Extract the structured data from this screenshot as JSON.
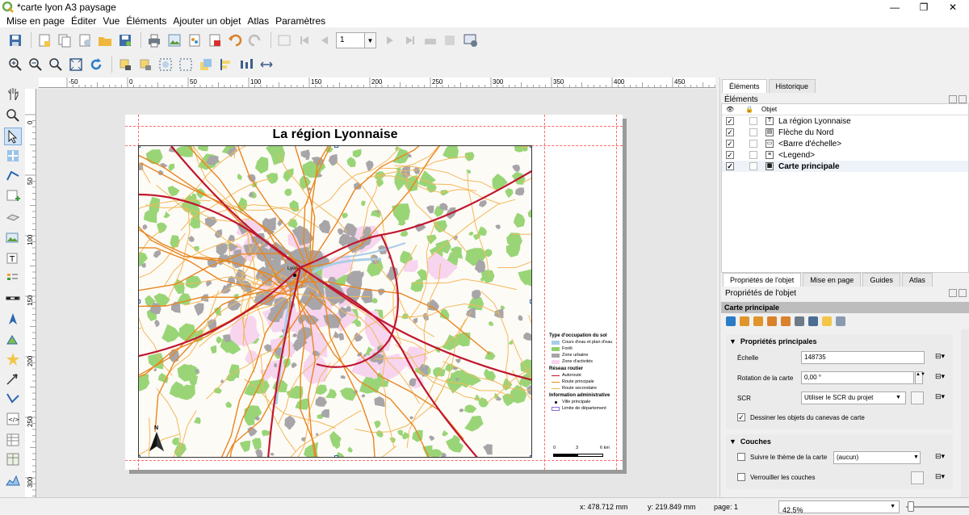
{
  "window": {
    "title": "*carte lyon A3 paysage",
    "minimize": "—",
    "maximize": "❐",
    "close": "✕"
  },
  "menu": [
    "Mise en page",
    "Éditer",
    "Vue",
    "Éléments",
    "Ajouter un objet",
    "Atlas",
    "Paramètres"
  ],
  "toolbar": {
    "page_value": "1"
  },
  "ruler": {
    "h_ticks": [
      "-50",
      "0",
      "50",
      "100",
      "150",
      "200",
      "250",
      "300",
      "350",
      "400",
      "450"
    ],
    "v_ticks": [
      "0",
      "50",
      "100",
      "150",
      "200",
      "250",
      "300"
    ]
  },
  "layout": {
    "map_title": "La région Lyonnaise",
    "city_label": "Lyon",
    "north_label": "N",
    "legend": {
      "sections": [
        {
          "heading": "Type d'occupation du sol",
          "items": [
            {
              "label": "Cours d'eau et plan d'eau",
              "kind": "fill",
              "color": "#a9cde8"
            },
            {
              "label": "Forêt",
              "kind": "fill",
              "color": "#8fd16a"
            },
            {
              "label": "Zone urbaine",
              "kind": "fill",
              "color": "#a7a5a8"
            },
            {
              "label": "Zone d'activités",
              "kind": "fill",
              "color": "#f7d5ee"
            }
          ]
        },
        {
          "heading": "Réseau routier",
          "items": [
            {
              "label": "Autoroute",
              "kind": "line",
              "color": "#c0172f"
            },
            {
              "label": "Route principale",
              "kind": "line",
              "color": "#e9861f"
            },
            {
              "label": "Route secondaire",
              "kind": "line",
              "color": "#f2b85a"
            }
          ]
        },
        {
          "heading": "Information administrative",
          "items": [
            {
              "label": "Ville principale",
              "kind": "point",
              "color": "#000000"
            },
            {
              "label": "Limite de département",
              "kind": "box",
              "color": "#8a6fd6"
            }
          ]
        }
      ]
    },
    "scalebar": {
      "labels": [
        "0",
        "3",
        "6 km"
      ]
    }
  },
  "dock": {
    "tabs_top": [
      "Éléments",
      "Historique"
    ],
    "items_title": "Éléments",
    "items_header": "Objet",
    "items": [
      {
        "label": "La région Lyonnaise",
        "icon": "T",
        "checked": "✓"
      },
      {
        "label": "Flèche du Nord",
        "icon": "▤",
        "checked": "✓"
      },
      {
        "label": "<Barre d'échelle>",
        "icon": "▭",
        "checked": "✓"
      },
      {
        "label": "<Legend>",
        "icon": "≡",
        "checked": "✓"
      },
      {
        "label": "Carte principale",
        "icon": "▦",
        "checked": "✓"
      }
    ],
    "tabs_bottom": [
      "Propriétés de l'objet",
      "Mise en page",
      "Guides",
      "Atlas"
    ],
    "props_title": "Propriétés de l'objet",
    "props_bar": "Carte principale",
    "main_props": {
      "heading": "Propriétés principales",
      "scale_label": "Échelle",
      "scale_value": "148735",
      "rotation_label": "Rotation de la carte",
      "rotation_value": "0,00 °",
      "crs_label": "SCR",
      "crs_value": "Utiliser le SCR du projet",
      "draw_canvas_label": "Dessiner les objets du canevas de carte",
      "draw_canvas_checked": "✓"
    },
    "layers": {
      "heading": "Couches",
      "follow_theme_label": "Suivre le thème de la carte",
      "follow_theme_value": "(aucun)",
      "lock_layers_label": "Verrouiller les couches"
    }
  },
  "status": {
    "x": "x: 478.712 mm",
    "y": "y: 219.849 mm",
    "page": "page: 1",
    "zoom": "42.5%"
  }
}
